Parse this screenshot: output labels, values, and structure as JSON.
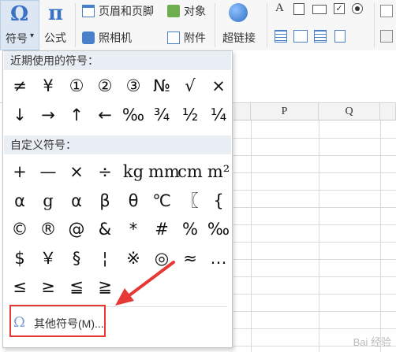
{
  "ribbon": {
    "symbol_button": {
      "icon_glyph": "Ω",
      "label": "符号",
      "caret": "▾"
    },
    "formula_button": {
      "icon_glyph": "π",
      "label": "公式"
    },
    "header_footer_label": "页眉和页脚",
    "object_label": "对象",
    "camera_label": "照相机",
    "attachment_label": "附件",
    "hyperlink_label": "超链接",
    "form_controls": [
      "A",
      "checkbox-icon",
      "rect-icon",
      "check-square-icon",
      "radio-icon"
    ]
  },
  "sheet": {
    "columns": [
      "P",
      "Q"
    ]
  },
  "panel": {
    "recent_header": "近期使用的符号：",
    "recent_symbols": [
      "≠",
      "¥",
      "①",
      "②",
      "③",
      "№",
      "√",
      "×",
      "↓",
      "→",
      "↑",
      "←",
      "‰",
      "¾",
      "½",
      "¼"
    ],
    "custom_header": "自定义符号：",
    "custom_symbols": [
      "+",
      "—",
      "×",
      "÷",
      "kg",
      "mm",
      "cm",
      "m²",
      "α",
      "g",
      "α",
      "β",
      "θ",
      "℃",
      "〖",
      "{",
      "©",
      "®",
      "@",
      "&",
      "*",
      "#",
      "%",
      "‰",
      "$",
      "￥",
      "§",
      "¦",
      "※",
      "◎",
      "≈",
      "…",
      "≤",
      "≥",
      "≦",
      "≧"
    ],
    "more": {
      "icon_glyph": "Ω",
      "label": "其他符号(M)..."
    }
  },
  "colors": {
    "highlight": "#dde7f3",
    "section_bg": "#e9eef4",
    "annotation_red": "#e53935",
    "omega_blue": "#3a73c6"
  },
  "watermark": "Bai 经验"
}
